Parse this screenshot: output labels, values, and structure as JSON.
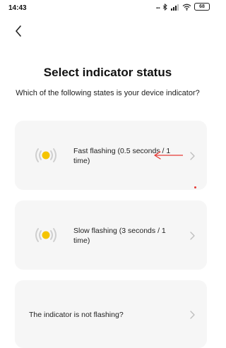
{
  "status_bar": {
    "time": "14:43",
    "signal_dots": "...",
    "bluetooth_icon": "bluetooth-icon",
    "signal_icon": "cellular-signal-icon",
    "wifi_icon": "wifi-icon",
    "battery_level": "68"
  },
  "header": {
    "back_icon": "chevron-left-icon"
  },
  "main": {
    "title": "Select indicator status",
    "subtitle": "Which of the following states is your device indicator?",
    "options": [
      {
        "label": "Fast flashing (0.5 seconds / 1 time)",
        "icon": "flashing-light-icon"
      },
      {
        "label": "Slow flashing (3 seconds / 1 time)",
        "icon": "flashing-light-icon"
      },
      {
        "label": "The indicator is not flashing?"
      }
    ]
  },
  "colors": {
    "indicator_yellow": "#f5c400",
    "indicator_waves": "#cfcfcf",
    "card_background": "#f6f6f6",
    "annotation_red": "#e53935",
    "chevron_gray": "#bdbdbd"
  }
}
